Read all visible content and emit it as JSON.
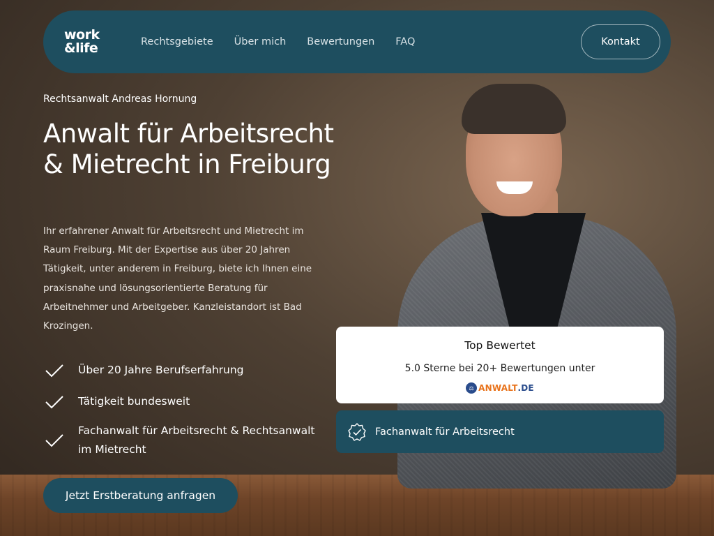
{
  "nav": {
    "logo_line1": "work",
    "logo_line2": "&life",
    "links": [
      "Rechtsgebiete",
      "Über mich",
      "Bewertungen",
      "FAQ"
    ],
    "contact_label": "Kontakt"
  },
  "hero": {
    "eyebrow": "Rechtsanwalt Andreas Hornung",
    "title": "Anwalt für Arbeitsrecht & Mietrecht in Freiburg",
    "text": "Ihr erfahrener Anwalt für Arbeitsrecht und Mietrecht im Raum Freiburg. Mit der Expertise aus über 20 Jahren Tätigkeit, unter anderem in Freiburg, biete ich Ihnen eine praxisnahe und lösungsorientierte Beratung für Arbeitnehmer und Arbeitgeber. Kanzleistandort ist Bad Krozingen.",
    "checks": [
      "Über 20 Jahre Berufserfahrung",
      "Tätigkeit bundesweit",
      "Fachanwalt für Arbeitsrecht & Rechtsanwalt im Mietrecht"
    ],
    "cta_label": "Jetzt Erstberatung anfragen"
  },
  "rating": {
    "title": "Top Bewertet",
    "text": "5.0 Sterne bei 20+ Bewertungen unter",
    "logo_part1": "ANWALT",
    "logo_part2": ".DE"
  },
  "badge": {
    "label": "Fachanwalt für Arbeitsrecht"
  },
  "colors": {
    "primary": "#1e4e5f",
    "background": "#4e4033",
    "card": "#ffffff",
    "anwalt_orange": "#e8731c",
    "anwalt_blue": "#2a4c8c"
  },
  "icons": [
    "check-icon",
    "verified-badge-icon",
    "anwalt-logo-icon"
  ]
}
